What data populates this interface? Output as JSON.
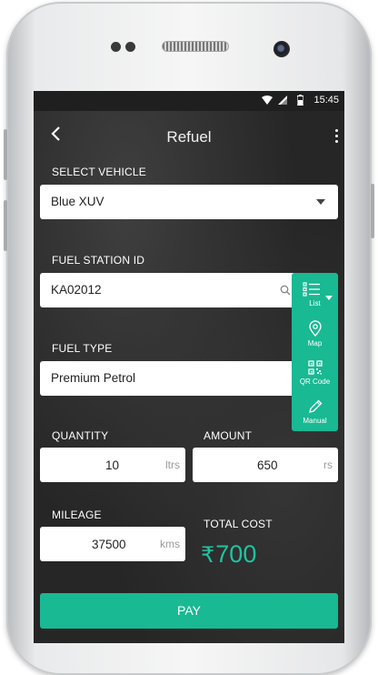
{
  "status_bar": {
    "time": "15:45"
  },
  "app_bar": {
    "title": "Refuel"
  },
  "select_vehicle": {
    "label": "SELECT VEHICLE",
    "value": "Blue XUV"
  },
  "fuel_station": {
    "label": "FUEL STATION ID",
    "value": "KA02012"
  },
  "fuel_type": {
    "label": "FUEL TYPE",
    "value": "Premium Petrol"
  },
  "quantity": {
    "label": "QUANTITY",
    "value": "10",
    "unit": "ltrs"
  },
  "amount": {
    "label": "AMOUNT",
    "value": "650",
    "unit": "rs"
  },
  "mileage": {
    "label": "MILEAGE",
    "value": "37500",
    "unit": "kms"
  },
  "total_cost": {
    "label": "TOTAL COST",
    "currency": "₹",
    "value": "700"
  },
  "pay_button": {
    "label": "PAY"
  },
  "side_menu": {
    "items": [
      {
        "label": "List",
        "icon": "list-icon"
      },
      {
        "label": "Map",
        "icon": "map-pin-icon"
      },
      {
        "label": "QR Code",
        "icon": "qr-code-icon"
      },
      {
        "label": "Manual",
        "icon": "pencil-icon"
      }
    ]
  },
  "colors": {
    "accent": "#18b993",
    "total_text": "#1ec4a0",
    "screen_bg": "#262626"
  }
}
